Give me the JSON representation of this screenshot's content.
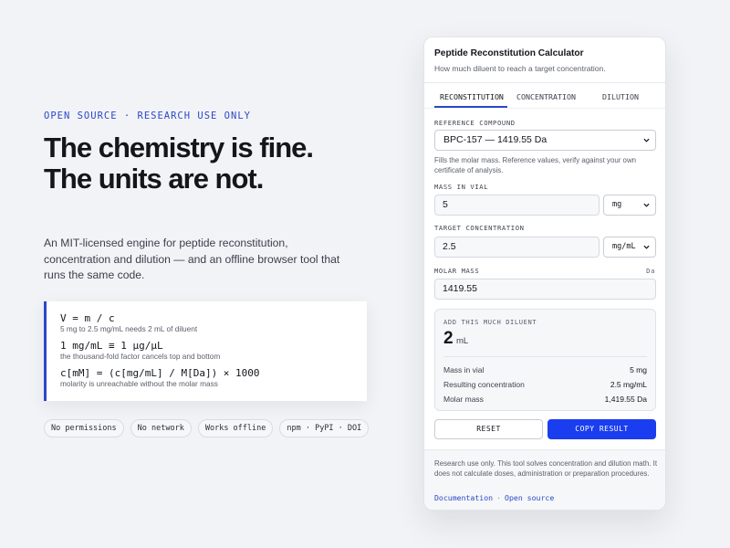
{
  "left": {
    "eyebrow": "OPEN SOURCE · RESEARCH USE ONLY",
    "headline": "The chemistry is fine. The units are not.",
    "lede": "An MIT-licensed engine for peptide reconstitution, concentration and dilution — and an offline browser tool that runs the same code.",
    "formulas": [
      {
        "expr": "V = m / c",
        "note": "5 mg to 2.5 mg/mL needs 2 mL of diluent"
      },
      {
        "expr": "1 mg/mL ≡ 1 µg/µL",
        "note": "the thousand-fold factor cancels top and bottom"
      },
      {
        "expr": "c[mM] = (c[mg/mL] / M[Da]) × 1000",
        "note": "molarity is unreachable without the molar mass"
      }
    ],
    "pills": [
      "No permissions",
      "No network",
      "Works offline",
      "npm · PyPI · DOI"
    ]
  },
  "card": {
    "title": "Peptide Reconstitution Calculator",
    "subtitle": "How much diluent to reach a target concentration.",
    "tabs": [
      "RECONSTITUTION",
      "CONCENTRATION",
      "DILUTION"
    ],
    "active_tab": "RECONSTITUTION",
    "reference": {
      "label": "REFERENCE COMPOUND",
      "selected": "BPC-157 — 1419.55 Da",
      "hint": "Fills the molar mass. Reference values, verify against your own certificate of analysis."
    },
    "mass": {
      "label": "MASS IN VIAL",
      "value": "5",
      "unit": "mg"
    },
    "target": {
      "label": "TARGET CONCENTRATION",
      "value": "2.5",
      "unit": "mg/mL"
    },
    "molar": {
      "label": "MOLAR MASS",
      "unit": "Da",
      "value": "1419.55"
    },
    "result": {
      "label": "ADD THIS MUCH DILUENT",
      "value": "2",
      "unit": "mL",
      "rows": [
        {
          "label": "Mass in vial",
          "value": "5 mg"
        },
        {
          "label": "Resulting concentration",
          "value": "2.5 mg/mL"
        },
        {
          "label": "Molar mass",
          "value": "1,419.55 Da"
        }
      ]
    },
    "reset_label": "RESET",
    "copy_label": "COPY RESULT",
    "footer": {
      "disclaimer": "Research use only. This tool solves concentration and dilution math. It does not calculate doses, administration or preparation procedures.",
      "links": [
        "Documentation",
        "Open source"
      ],
      "separator": "·"
    }
  },
  "colors": {
    "accent": "#2b48c9",
    "primary_button": "#1a3df0",
    "background": "#f2f3f6"
  }
}
